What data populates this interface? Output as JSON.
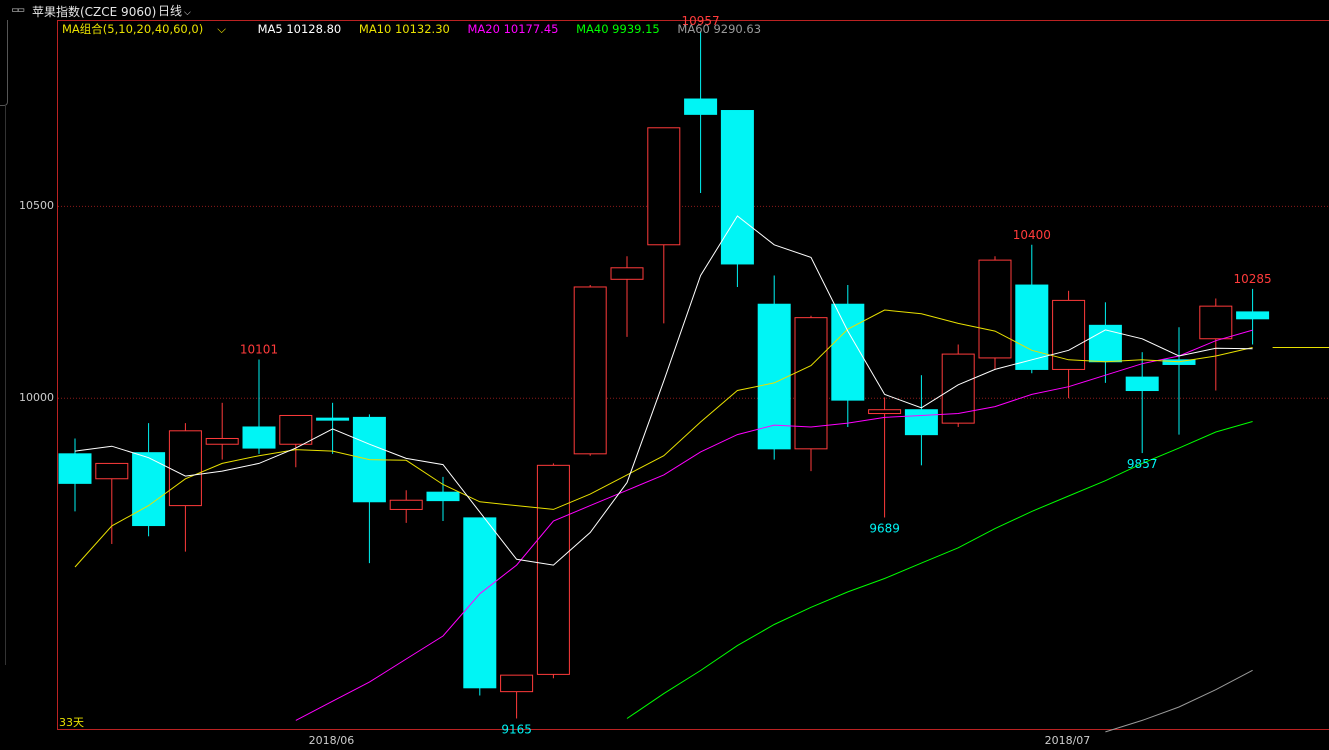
{
  "header": {
    "chain_icon_text": "▭▭",
    "symbol": "苹果指数(CZCE 9060)",
    "period": "日线",
    "period_icon": "chevron-down-icon"
  },
  "legend": {
    "combo": "MA组合(5,10,20,40,60,0)",
    "ma5": "MA5 10128.80",
    "ma10": "MA10 10132.30",
    "ma20": "MA20 10177.45",
    "ma40": "MA40 9939.15",
    "ma60": "MA60 9290.63",
    "colors": {
      "combo": "#e8e000",
      "ma5": "#ffffff",
      "ma10": "#e8e000",
      "ma20": "#ff00ff",
      "ma40": "#00ff00",
      "ma60": "#9a9a9a"
    }
  },
  "days_label": "33天",
  "colors": {
    "up": "#ff3b3b",
    "down": "#00f5f5",
    "grid": "#8b1a1a",
    "annot_high": "#ff3b3b",
    "annot_low": "#00f5f5"
  },
  "chart_data": {
    "type": "candlestick",
    "y_ticks": [
      10000,
      10500
    ],
    "y_tick_labels": [
      "10000",
      "10500"
    ],
    "ylim": [
      9135,
      10986
    ],
    "x_tick_labels": [
      "2018/06",
      "2018/07"
    ],
    "x_tick_index": [
      7,
      27
    ],
    "candles": [
      {
        "o": 9855,
        "h": 9895,
        "l": 9705,
        "c": 9778,
        "dir": "down"
      },
      {
        "o": 9790,
        "h": 9810,
        "l": 9620,
        "c": 9830,
        "dir": "up"
      },
      {
        "o": 9858,
        "h": 9935,
        "l": 9640,
        "c": 9668,
        "dir": "down"
      },
      {
        "o": 9720,
        "h": 9935,
        "l": 9600,
        "c": 9915,
        "dir": "up"
      },
      {
        "o": 9880,
        "h": 9988,
        "l": 9840,
        "c": 9895,
        "dir": "up"
      },
      {
        "o": 9925,
        "h": 10101,
        "l": 9855,
        "c": 9870,
        "dir": "down"
      },
      {
        "o": 9880,
        "h": 9950,
        "l": 9820,
        "c": 9955,
        "dir": "up"
      },
      {
        "o": 9948,
        "h": 9988,
        "l": 9855,
        "c": 9948,
        "dir": "down"
      },
      {
        "o": 9950,
        "h": 9958,
        "l": 9570,
        "c": 9730,
        "dir": "down"
      },
      {
        "o": 9710,
        "h": 9760,
        "l": 9675,
        "c": 9734,
        "dir": "up"
      },
      {
        "o": 9755,
        "h": 9795,
        "l": 9680,
        "c": 9733,
        "dir": "down"
      },
      {
        "o": 9688,
        "h": 9688,
        "l": 9225,
        "c": 9245,
        "dir": "down"
      },
      {
        "o": 9235,
        "h": 9255,
        "l": 9165,
        "c": 9278,
        "dir": "up"
      },
      {
        "o": 9280,
        "h": 9830,
        "l": 9270,
        "c": 9825,
        "dir": "up"
      },
      {
        "o": 9855,
        "h": 10295,
        "l": 9850,
        "c": 10290,
        "dir": "up"
      },
      {
        "o": 10310,
        "h": 10370,
        "l": 10160,
        "c": 10340,
        "dir": "up"
      },
      {
        "o": 10400,
        "h": 10700,
        "l": 10195,
        "c": 10705,
        "dir": "up"
      },
      {
        "o": 10780,
        "h": 10957,
        "l": 10535,
        "c": 10740,
        "dir": "down"
      },
      {
        "o": 10750,
        "h": 10350,
        "l": 10290,
        "c": 10350,
        "dir": "down"
      },
      {
        "o": 10245,
        "h": 10320,
        "l": 9840,
        "c": 9868,
        "dir": "down"
      },
      {
        "o": 9868,
        "h": 10215,
        "l": 9810,
        "c": 10210,
        "dir": "up"
      },
      {
        "o": 10245,
        "h": 10295,
        "l": 9925,
        "c": 9995,
        "dir": "down"
      },
      {
        "o": 9960,
        "h": 10002,
        "l": 9689,
        "c": 9970,
        "dir": "up"
      },
      {
        "o": 9970,
        "h": 10060,
        "l": 9825,
        "c": 9905,
        "dir": "down"
      },
      {
        "o": 9935,
        "h": 10140,
        "l": 9925,
        "c": 10115,
        "dir": "up"
      },
      {
        "o": 10105,
        "h": 10370,
        "l": 10075,
        "c": 10360,
        "dir": "up"
      },
      {
        "o": 10295,
        "h": 10400,
        "l": 10065,
        "c": 10075,
        "dir": "down"
      },
      {
        "o": 10075,
        "h": 10280,
        "l": 10000,
        "c": 10255,
        "dir": "up"
      },
      {
        "o": 10190,
        "h": 10250,
        "l": 10040,
        "c": 10095,
        "dir": "down"
      },
      {
        "o": 10055,
        "h": 10120,
        "l": 9857,
        "c": 10020,
        "dir": "down"
      },
      {
        "o": 10100,
        "h": 10185,
        "l": 9905,
        "c": 10088,
        "dir": "down"
      },
      {
        "o": 10155,
        "h": 10260,
        "l": 10020,
        "c": 10240,
        "dir": "up"
      },
      {
        "o": 10225,
        "h": 10285,
        "l": 10140,
        "c": 10207,
        "dir": "down"
      }
    ],
    "ma5": [
      9862,
      9875,
      9845,
      9797,
      9810,
      9830,
      9870,
      9920,
      9880,
      9843,
      9827,
      9703,
      9580,
      9565,
      9650,
      9780,
      10045,
      10320,
      10475,
      10400,
      10367,
      10175,
      10010,
      9975,
      10035,
      10075,
      10100,
      10125,
      10178,
      10155,
      10110,
      10130,
      10128.8
    ],
    "ma10": [
      9560,
      9667,
      9720,
      9790,
      9830,
      9850,
      9866,
      9862,
      9840,
      9838,
      9775,
      9730,
      9720,
      9710,
      9750,
      9800,
      9850,
      9938,
      10020,
      10040,
      10085,
      10180,
      10230,
      10220,
      10195,
      10175,
      10125,
      10100,
      10095,
      10100,
      10095,
      10110,
      10132.3
    ],
    "ma20": [
      null,
      null,
      null,
      null,
      null,
      null,
      9160,
      9210,
      9260,
      9320,
      9380,
      9490,
      9565,
      9680,
      9720,
      9760,
      9800,
      9860,
      9905,
      9930,
      9925,
      9935,
      9950,
      9955,
      9960,
      9978,
      10010,
      10030,
      10060,
      10090,
      10110,
      10150,
      10177.45
    ],
    "ma40": [
      null,
      null,
      null,
      null,
      null,
      null,
      null,
      null,
      null,
      null,
      null,
      null,
      null,
      null,
      null,
      9165,
      9230,
      9290,
      9355,
      9410,
      9455,
      9495,
      9530,
      9570,
      9610,
      9660,
      9705,
      9745,
      9785,
      9830,
      9870,
      9912,
      9939.15
    ],
    "ma60": [
      null,
      null,
      null,
      null,
      null,
      null,
      null,
      null,
      null,
      null,
      null,
      null,
      null,
      null,
      null,
      null,
      null,
      null,
      null,
      null,
      null,
      null,
      null,
      null,
      null,
      null,
      null,
      null,
      9130,
      9160,
      9195,
      9240,
      9290.63
    ],
    "annotations": [
      {
        "index": 5,
        "text": "10101",
        "at": "high",
        "kind": "high"
      },
      {
        "index": 12,
        "text": "9165",
        "at": "low",
        "kind": "low"
      },
      {
        "index": 17,
        "text": "10957",
        "at": "high",
        "kind": "high"
      },
      {
        "index": 22,
        "text": "9689",
        "at": "low",
        "kind": "low"
      },
      {
        "index": 26,
        "text": "10400",
        "at": "high",
        "kind": "high"
      },
      {
        "index": 29,
        "text": "9857",
        "at": "low",
        "kind": "low"
      },
      {
        "index": 32,
        "text": "10285",
        "at": "high",
        "kind": "high"
      }
    ]
  }
}
